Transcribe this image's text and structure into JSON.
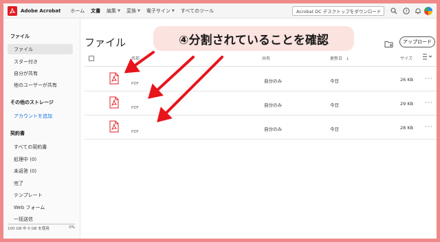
{
  "topbar": {
    "app_name": "Adobe Acrobat",
    "nav": [
      {
        "label": "ホーム",
        "caret": false
      },
      {
        "label": "文書",
        "caret": false
      },
      {
        "label": "編集",
        "caret": true
      },
      {
        "label": "変換",
        "caret": true
      },
      {
        "label": "電子サイン",
        "caret": true
      },
      {
        "label": "すべてのツール",
        "caret": false
      }
    ],
    "search_text": "Acrobat DC デスクトップをダウンロード"
  },
  "sidebar": {
    "files_heading": "ファイル",
    "files_items": [
      "ファイル",
      "スター付き",
      "自分が共有",
      "他のユーザーが共有"
    ],
    "storage_heading": "その他のストレージ",
    "storage_link": "アカウントを追加",
    "contracts_heading": "契約書",
    "contracts_items": [
      "すべての契約書",
      "処理中 (0)",
      "未返答 (0)",
      "完了",
      "テンプレート",
      "Web フォーム",
      "一括送信"
    ],
    "storage_used": "100 GB 中 0 GB を使用",
    "storage_percent": "0%"
  },
  "main": {
    "title": "ファイル",
    "upload_label": "アップロード",
    "columns": {
      "name": "名前",
      "shared": "共有",
      "updated": "更新日",
      "sort_arrow": "↓",
      "size": "サイズ"
    },
    "rows": [
      {
        "type": "PDF",
        "shared": "自分のみ",
        "updated": "今日",
        "size": "26 KB"
      },
      {
        "type": "PDF",
        "shared": "自分のみ",
        "updated": "今日",
        "size": "29 KB"
      },
      {
        "type": "PDF",
        "shared": "自分のみ",
        "updated": "今日",
        "size": "28 KB"
      }
    ],
    "more_glyph": "···"
  },
  "annotation": {
    "callout_text": "④分割されていることを確認",
    "arrow_color": "#e8141c",
    "accent_color": "#e11b22"
  }
}
